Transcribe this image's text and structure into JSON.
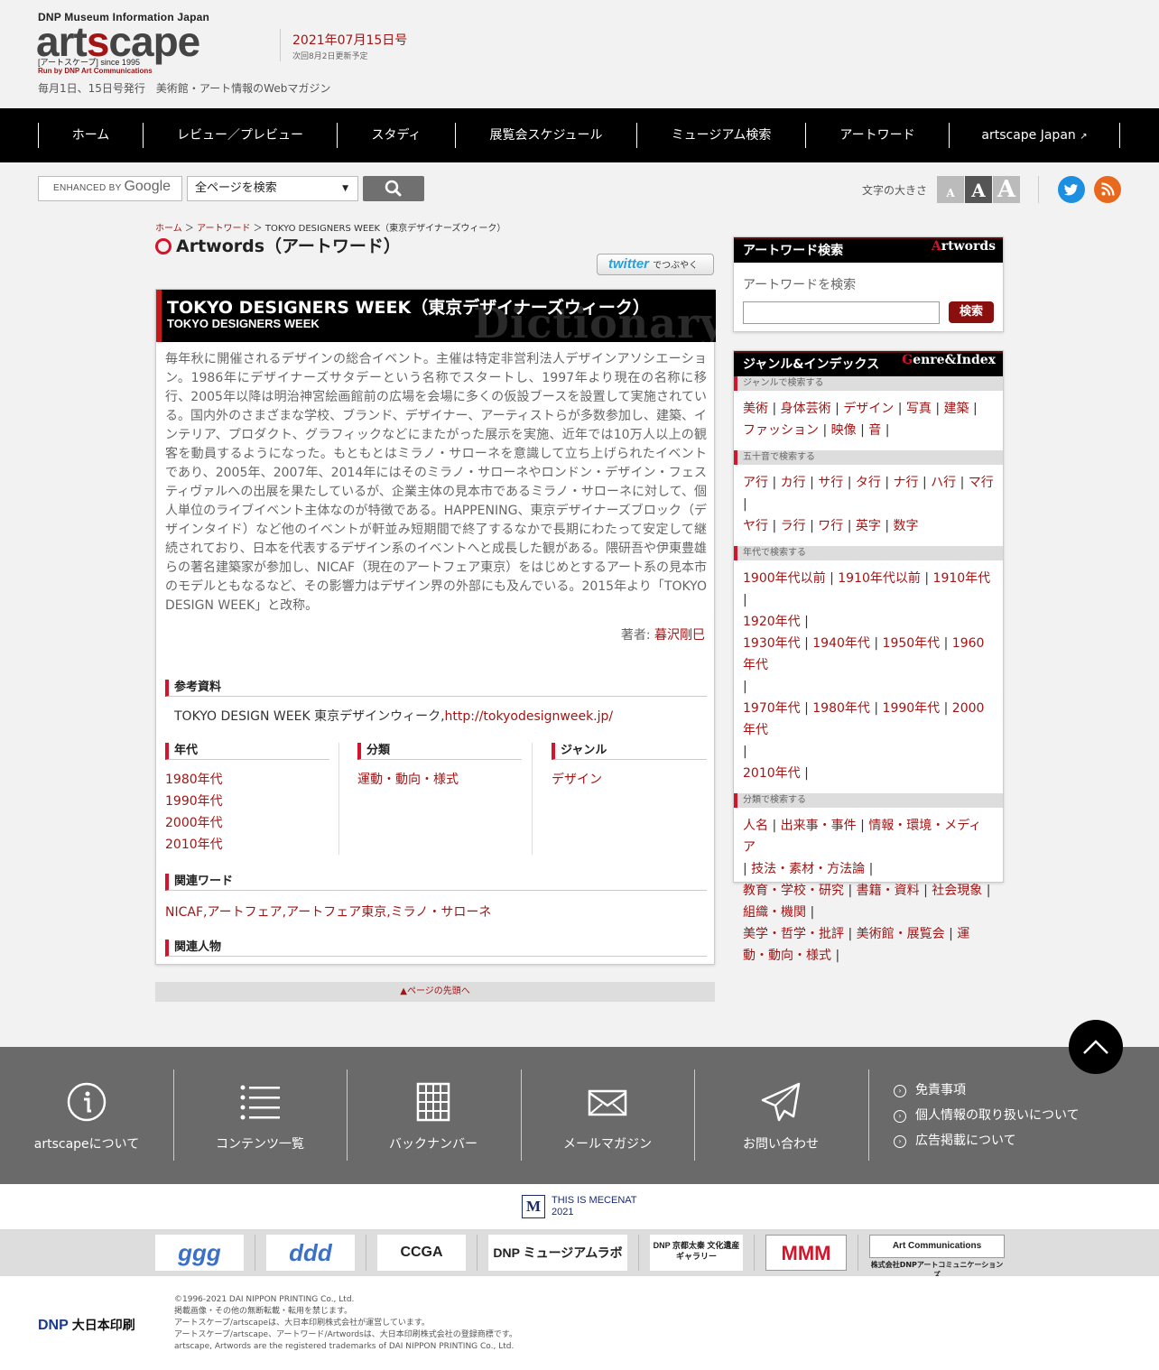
{
  "header": {
    "logo_top": "DNP Museum Information Japan",
    "logo_main_a": "art",
    "logo_main_c": "s",
    "logo_main_b": "cape",
    "logo_sub1": "[アートスケープ] since 1995",
    "logo_sub2": "Run by DNP Art Communications",
    "tagline": "毎月1日、15日号発行　美術館・アート情報のWebマガジン",
    "issue_date": "2021年07月15日号",
    "next_update": "次回8月2日更新予定"
  },
  "nav": {
    "items": [
      "ホーム",
      "レビュー／プレビュー",
      "スタディ",
      "展覧会スケジュール",
      "ミュージアム検索",
      "アートワード",
      "artscape Japan"
    ]
  },
  "search": {
    "google_prefix": "ENHANCED BY",
    "google_word": "Google",
    "scope": "全ページを検索",
    "fontsize_label": "文字の大きさ",
    "fontsize_glyph": "A"
  },
  "breadcrumb": {
    "home": "ホーム",
    "sep": "＞",
    "artword": "アートワード",
    "current": "TOKYO DESIGNERS WEEK（東京デザイナーズウィーク）"
  },
  "page_title": "Artwords（アートワード）",
  "tweet": {
    "label": "twitter",
    "sub": "でつぶやく"
  },
  "article": {
    "title": "TOKYO DESIGNERS WEEK（東京デザイナーズウィーク）",
    "subtitle": "TOKYO DESIGNERS WEEK",
    "watermark": "Dictionary",
    "body": "毎年秋に開催されるデザインの総合イベント。主催は特定非営利法人デザインアソシエーション。1986年にデザイナーズサタデーという名称でスタートし、1997年より現在の名称に移行、2005年以降は明治神宮絵画館前の広場を会場に多くの仮設ブースを設置して実施されている。国内外のさまざまな学校、ブランド、デザイナー、アーティストらが多数参加し、建築、インテリア、プロダクト、グラフィックなどにまたがった展示を実施、近年では10万人以上の観客を動員するようになった。もともとはミラノ・サローネを意識して立ち上げられたイベントであり、2005年、2007年、2014年にはそのミラノ・サローネやロンドン・デザイン・フェスティヴァルへの出展を果たしているが、企業主体の見本市であるミラノ・サローネに対して、個人単位のライブイベント主体なのが特徴である。HAPPENING、東京デザイナーズブロック（デザインタイド）など他のイベントが軒並み短期間で終了するなかで長期にわたって安定して継続されており、日本を代表するデザイン系のイベントへと成長した観がある。隈研吾や伊東豊雄らの著名建築家が参加し、NICAF（現在のアートフェア東京）をはじめとするアート系の見本市のモデルともなるなど、その影響力はデザイン界の外部にも及んでいる。2015年より「TOKYO DESIGN WEEK」と改称。",
    "author_label": "著者: ",
    "author": "暮沢剛巳",
    "ref_heading": "参考資料",
    "ref_text": "TOKYO DESIGN WEEK 東京デザインウィーク,",
    "ref_link": "http://tokyodesignweek.jp/",
    "era_heading": "年代",
    "eras": [
      "1980年代",
      "1990年代",
      "2000年代",
      "2010年代"
    ],
    "class_heading": "分類",
    "classes": [
      "運動・動向・様式"
    ],
    "genre_heading": "ジャンル",
    "genres": [
      "デザイン"
    ],
    "related_heading": "関連ワード",
    "related_words": "NICAF,アートフェア,アートフェア東京,ミラノ・サローネ",
    "people_heading": "関連人物"
  },
  "to_top": "▲ページの先頭へ",
  "sidebar": {
    "aw_search_title": "アートワード検索",
    "aw_search_en_initial": "A",
    "aw_search_en_rest": "rtwords",
    "aw_search_label": "アートワードを検索",
    "aw_search_btn": "検索",
    "genre_title": "ジャンル&インデックス",
    "genre_en_initial": "G",
    "genre_en_rest": "enre&Index",
    "sub_genre": "ジャンルで検索する",
    "genres": [
      "美術",
      "身体芸術",
      "デザイン",
      "写真",
      "建築",
      "ファッション",
      "映像",
      "音"
    ],
    "sub_kana": "五十音で検索する",
    "kana": [
      "ア行",
      "カ行",
      "サ行",
      "タ行",
      "ナ行",
      "ハ行",
      "マ行",
      "ヤ行",
      "ラ行",
      "ワ行",
      "英字",
      "数字"
    ],
    "sub_era": "年代で検索する",
    "eras": [
      "1900年代以前",
      "1910年代以前",
      "1910年代",
      "1920年代",
      "1930年代",
      "1940年代",
      "1950年代",
      "1960年代",
      "1970年代",
      "1980年代",
      "1990年代",
      "2000年代",
      "2010年代"
    ],
    "sub_class": "分類で検索する",
    "classes": [
      "人名",
      "出来事・事件",
      "情報・環境・メディア",
      "技法・素材・方法論",
      "教育・学校・研究",
      "書籍・資料",
      "社会現象",
      "組織・機関",
      "美学・哲学・批評",
      "美術館・展覧会",
      "運動・動向・様式"
    ],
    "sep": "|"
  },
  "footer": {
    "items": [
      "artscapeについて",
      "コンテンツ一覧",
      "バックナンバー",
      "メールマガジン",
      "お問い合わせ"
    ],
    "links": [
      "免責事項",
      "個人情報の取り扱いについて",
      "広告掲載について"
    ],
    "link_glyph": "›",
    "mecenat_mark": "M",
    "mecenat_line1": "THIS IS MECENAT",
    "mecenat_line2": "2021",
    "partner_logos": [
      "ggg",
      "ddd",
      "CCGA",
      "DNP ミュージアムラボ",
      "DNP 京都太秦 文化遺産ギャラリー",
      "MMM",
      "Art Communications"
    ],
    "partner_caption": "株式会社DNPアートコミュニケーションズ",
    "dnp_mark": "DNP",
    "dnp_name": "大日本印刷",
    "copyright": [
      "©1996-2021 DAI NIPPON PRINTING Co., Ltd.",
      "掲載画像・その他の無断転載・転用を禁じます。",
      "アートスケープ/artscapeは、大日本印刷株式会社が運営しています。",
      "アートスケープ/artscape、アートワード/Artwordsは、大日本印刷株式会社の登録商標です。",
      "artscape, Artwords are the registered trademarks of DAI NIPPON PRINTING Co., Ltd."
    ]
  },
  "colors": {
    "accent": "#a31414",
    "red_bar": "#d4142b",
    "nav_bg": "#000000",
    "footer_bg": "#6a6a6a"
  }
}
